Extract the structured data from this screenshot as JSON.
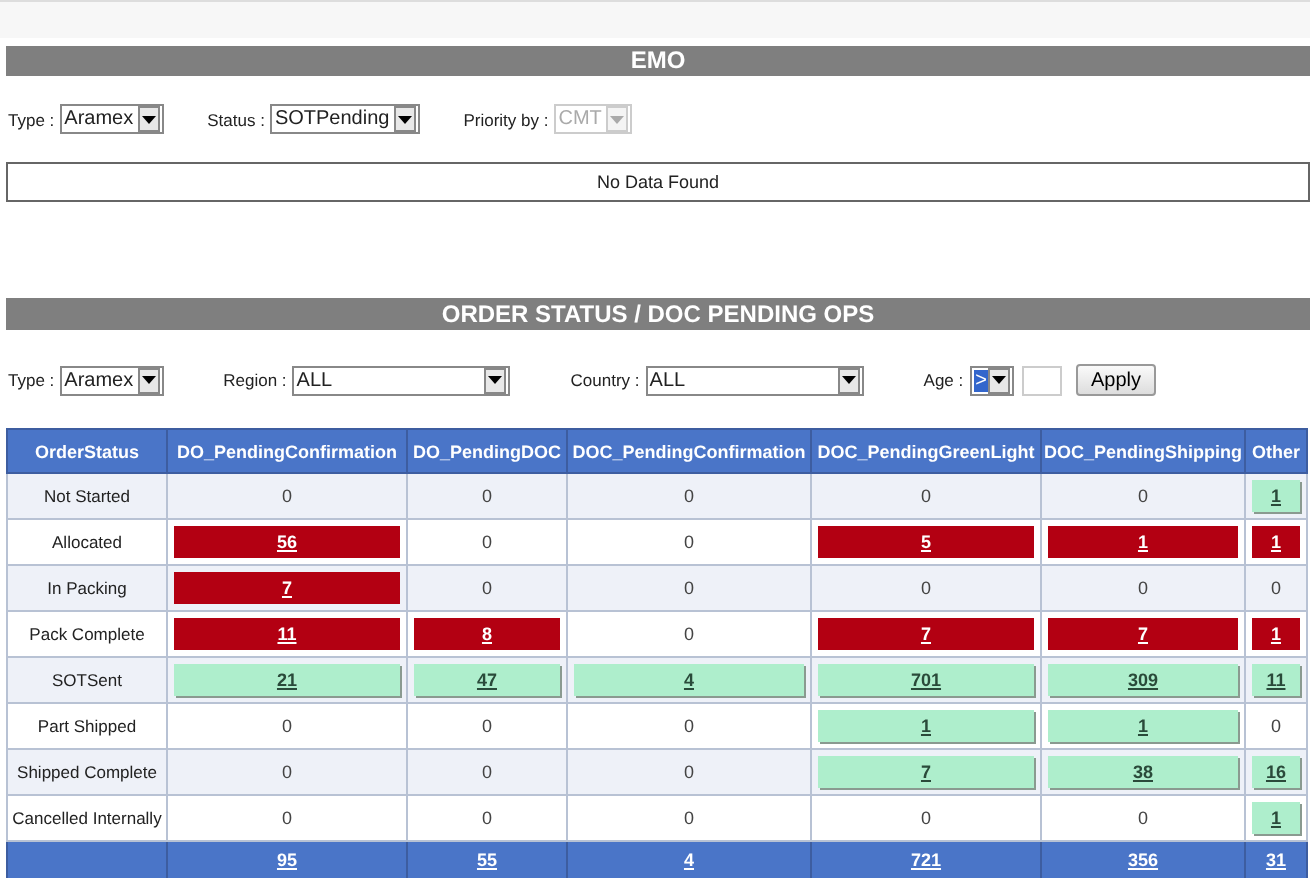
{
  "emo": {
    "title": "EMO",
    "filters": [
      {
        "label": "Type :",
        "value": "Aramex",
        "disabled": false
      },
      {
        "label": "Status :",
        "value": "SOTPending",
        "disabled": false
      },
      {
        "label": "Priority by :",
        "value": "CMT",
        "disabled": true
      }
    ],
    "message": "No Data Found"
  },
  "orders": {
    "title": "ORDER STATUS / DOC PENDING OPS",
    "filters": [
      {
        "label": "Type :",
        "value": "Aramex"
      },
      {
        "label": "Region :",
        "value": "ALL"
      },
      {
        "label": "Country :",
        "value": "ALL"
      }
    ],
    "age": {
      "label": "Age :",
      "value": ">",
      "selected": true
    },
    "apply": "Apply",
    "columns": [
      "OrderStatus",
      "DO_PendingConfirmation",
      "DO_PendingDOC",
      "DOC_PendingConfirmation",
      "DOC_PendingGreenLight",
      "DOC_PendingShipping",
      "Other"
    ],
    "rows": [
      {
        "cells": [
          {
            "value": "Not Started",
            "kind": "label"
          },
          {
            "value": "0",
            "kind": "plain"
          },
          {
            "value": "0",
            "kind": "plain"
          },
          {
            "value": "0",
            "kind": "plain"
          },
          {
            "value": "0",
            "kind": "plain"
          },
          {
            "value": "0",
            "kind": "plain"
          },
          {
            "value": "1",
            "kind": "ok"
          }
        ]
      },
      {
        "cells": [
          {
            "value": "Allocated",
            "kind": "label"
          },
          {
            "value": "56",
            "kind": "alert"
          },
          {
            "value": "0",
            "kind": "plain"
          },
          {
            "value": "0",
            "kind": "plain"
          },
          {
            "value": "5",
            "kind": "alert"
          },
          {
            "value": "1",
            "kind": "alert"
          },
          {
            "value": "1",
            "kind": "alert"
          }
        ]
      },
      {
        "cells": [
          {
            "value": "In Packing",
            "kind": "label"
          },
          {
            "value": "7",
            "kind": "alert"
          },
          {
            "value": "0",
            "kind": "plain"
          },
          {
            "value": "0",
            "kind": "plain"
          },
          {
            "value": "0",
            "kind": "plain"
          },
          {
            "value": "0",
            "kind": "plain"
          },
          {
            "value": "0",
            "kind": "plain"
          }
        ]
      },
      {
        "cells": [
          {
            "value": "Pack Complete",
            "kind": "label"
          },
          {
            "value": "11",
            "kind": "alert"
          },
          {
            "value": "8",
            "kind": "alert"
          },
          {
            "value": "0",
            "kind": "plain"
          },
          {
            "value": "7",
            "kind": "alert"
          },
          {
            "value": "7",
            "kind": "alert"
          },
          {
            "value": "1",
            "kind": "alert"
          }
        ]
      },
      {
        "cells": [
          {
            "value": "SOTSent",
            "kind": "label"
          },
          {
            "value": "21",
            "kind": "ok"
          },
          {
            "value": "47",
            "kind": "ok"
          },
          {
            "value": "4",
            "kind": "ok"
          },
          {
            "value": "701",
            "kind": "ok"
          },
          {
            "value": "309",
            "kind": "ok"
          },
          {
            "value": "11",
            "kind": "ok"
          }
        ]
      },
      {
        "cells": [
          {
            "value": "Part Shipped",
            "kind": "label"
          },
          {
            "value": "0",
            "kind": "plain"
          },
          {
            "value": "0",
            "kind": "plain"
          },
          {
            "value": "0",
            "kind": "plain"
          },
          {
            "value": "1",
            "kind": "ok"
          },
          {
            "value": "1",
            "kind": "ok"
          },
          {
            "value": "0",
            "kind": "plain"
          }
        ]
      },
      {
        "cells": [
          {
            "value": "Shipped Complete",
            "kind": "label"
          },
          {
            "value": "0",
            "kind": "plain"
          },
          {
            "value": "0",
            "kind": "plain"
          },
          {
            "value": "0",
            "kind": "plain"
          },
          {
            "value": "7",
            "kind": "ok"
          },
          {
            "value": "38",
            "kind": "ok"
          },
          {
            "value": "16",
            "kind": "ok"
          }
        ]
      },
      {
        "cells": [
          {
            "value": "Cancelled Internally",
            "kind": "label"
          },
          {
            "value": "0",
            "kind": "plain"
          },
          {
            "value": "0",
            "kind": "plain"
          },
          {
            "value": "0",
            "kind": "plain"
          },
          {
            "value": "0",
            "kind": "plain"
          },
          {
            "value": "0",
            "kind": "plain"
          },
          {
            "value": "1",
            "kind": "ok"
          }
        ]
      }
    ],
    "totals": {
      "cells": [
        {
          "kind": "blank"
        },
        {
          "value": "95",
          "kind": "total"
        },
        {
          "value": "55",
          "kind": "total"
        },
        {
          "value": "4",
          "kind": "total"
        },
        {
          "value": "721",
          "kind": "total"
        },
        {
          "value": "356",
          "kind": "total"
        },
        {
          "value": "31",
          "kind": "total"
        }
      ]
    }
  }
}
